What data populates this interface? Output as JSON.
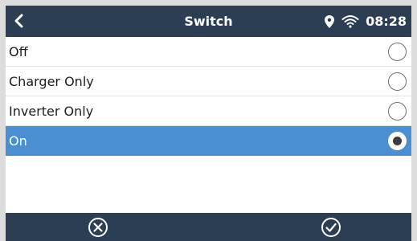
{
  "header": {
    "title": "Switch",
    "time": "08:28",
    "icons": [
      "back-chevron-icon",
      "location-pin-icon",
      "wifi-icon"
    ]
  },
  "options": [
    {
      "label": "Off",
      "selected": false
    },
    {
      "label": "Charger Only",
      "selected": false
    },
    {
      "label": "Inverter Only",
      "selected": false
    },
    {
      "label": "On",
      "selected": true
    }
  ],
  "footer": {
    "icons": [
      "cancel-circle-x-icon",
      "confirm-circle-check-icon"
    ]
  },
  "colors": {
    "bar": "#2b3e54",
    "selected_row": "#4a8fd2",
    "background": "#ffffff"
  }
}
